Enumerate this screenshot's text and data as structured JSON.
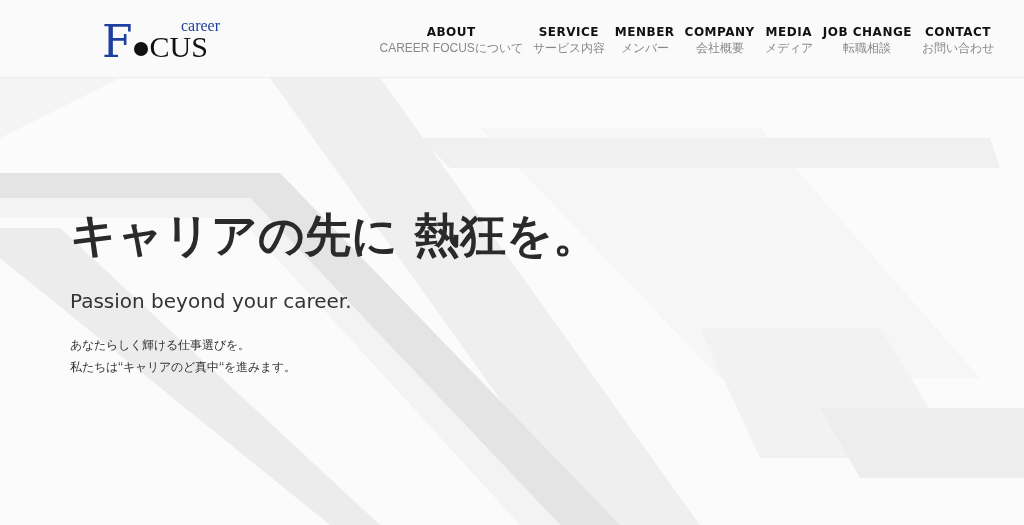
{
  "logo": {
    "letter": "F",
    "rest": "CUS",
    "tagline": "career"
  },
  "nav": [
    {
      "label": "ABOUT",
      "sub": "CAREER FOCUSについて"
    },
    {
      "label": "SERVICE",
      "sub": "サービス内容"
    },
    {
      "label": "MENBER",
      "sub": "メンバー"
    },
    {
      "label": "COMPANY",
      "sub": "会社概要"
    },
    {
      "label": "MEDIA",
      "sub": "メディア"
    },
    {
      "label": "JOB CHANGE",
      "sub": "転職相談"
    },
    {
      "label": "CONTACT",
      "sub": "お問い合わせ"
    }
  ],
  "hero": {
    "headline": "キャリアの先に 熱狂を。",
    "subheadline": "Passion beyond your career.",
    "lines": [
      "あなたらしく輝ける仕事選びを。",
      "私たちは‘‘キャリアのど真中‘‘を進みます。"
    ]
  }
}
